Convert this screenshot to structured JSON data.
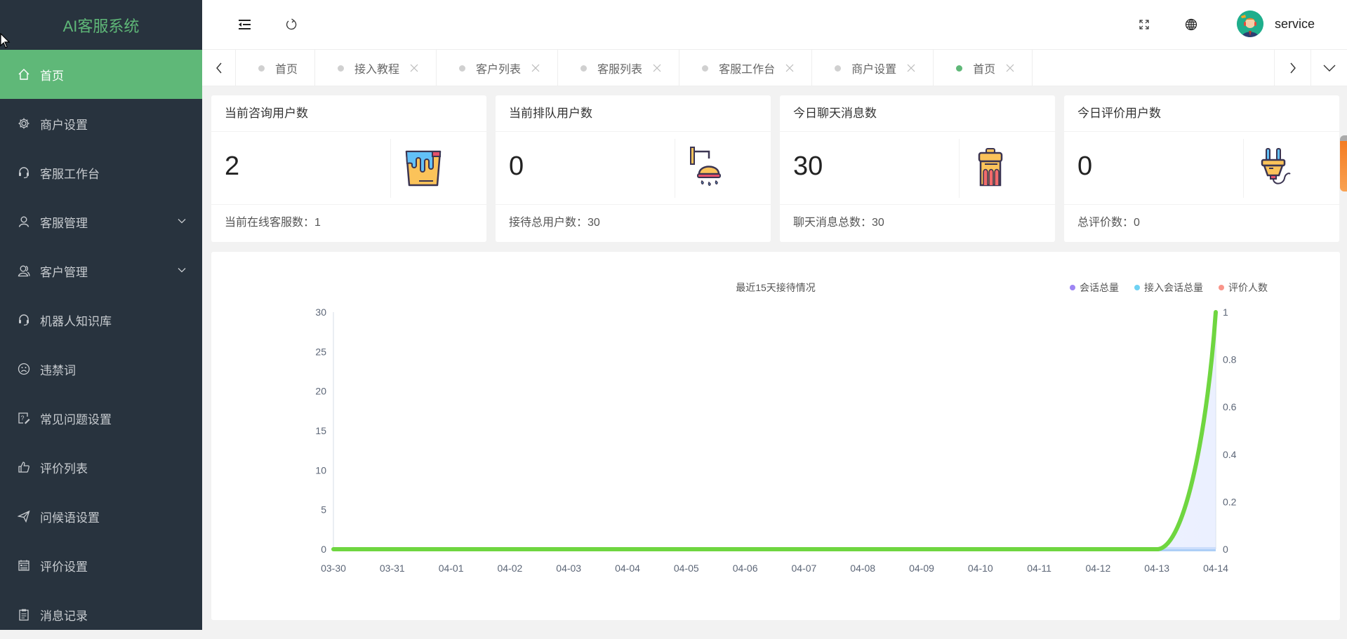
{
  "app": {
    "title": "AI客服系统"
  },
  "sidebar": {
    "items": [
      {
        "label": "首页",
        "icon": "home-icon",
        "active": true,
        "expandable": false
      },
      {
        "label": "商户设置",
        "icon": "gear-icon",
        "active": false,
        "expandable": false
      },
      {
        "label": "客服工作台",
        "icon": "headset-icon",
        "active": false,
        "expandable": false
      },
      {
        "label": "客服管理",
        "icon": "user-icon",
        "active": false,
        "expandable": true
      },
      {
        "label": "客户管理",
        "icon": "users-icon",
        "active": false,
        "expandable": true
      },
      {
        "label": "机器人知识库",
        "icon": "headset-icon",
        "active": false,
        "expandable": false
      },
      {
        "label": "违禁词",
        "icon": "sad-face-icon",
        "active": false,
        "expandable": false
      },
      {
        "label": "常见问题设置",
        "icon": "question-edit-icon",
        "active": false,
        "expandable": false
      },
      {
        "label": "评价列表",
        "icon": "thumbs-up-icon",
        "active": false,
        "expandable": false
      },
      {
        "label": "问候语设置",
        "icon": "paper-plane-icon",
        "active": false,
        "expandable": false
      },
      {
        "label": "评价设置",
        "icon": "calendar-list-icon",
        "active": false,
        "expandable": false
      },
      {
        "label": "消息记录",
        "icon": "clipboard-icon",
        "active": false,
        "expandable": false
      }
    ]
  },
  "header": {
    "collapse_icon": "menu-fold-icon",
    "refresh_icon": "refresh-icon",
    "fullscreen_icon": "fullscreen-icon",
    "language_icon": "globe-icon",
    "username": "service"
  },
  "tabs": [
    {
      "label": "首页",
      "closable": false,
      "active": false
    },
    {
      "label": "接入教程",
      "closable": true,
      "active": false
    },
    {
      "label": "客户列表",
      "closable": true,
      "active": false
    },
    {
      "label": "客服列表",
      "closable": true,
      "active": false
    },
    {
      "label": "客服工作台",
      "closable": true,
      "active": false
    },
    {
      "label": "商户设置",
      "closable": true,
      "active": false
    },
    {
      "label": "首页",
      "closable": true,
      "active": true
    }
  ],
  "cards": [
    {
      "title": "当前咨询用户数",
      "value": "2",
      "footer": "当前在线客服数：1",
      "icon": "paint-bucket-icon"
    },
    {
      "title": "当前排队用户数",
      "value": "0",
      "footer": "接待总用户数：30",
      "icon": "shower-icon"
    },
    {
      "title": "今日聊天消息数",
      "value": "30",
      "footer": "聊天消息总数：30",
      "icon": "trash-can-icon"
    },
    {
      "title": "今日评价用户数",
      "value": "0",
      "footer": "总评价数：0",
      "icon": "plug-icon"
    }
  ],
  "colors": {
    "brand": "#5fb878",
    "sidebar_bg": "#28333e"
  },
  "chart_data": {
    "type": "line",
    "title": "最近15天接待情况",
    "legend_position": "top-right",
    "categories": [
      "03-30",
      "03-31",
      "04-01",
      "04-02",
      "04-03",
      "04-04",
      "04-05",
      "04-06",
      "04-07",
      "04-08",
      "04-09",
      "04-10",
      "04-11",
      "04-12",
      "04-13",
      "04-14"
    ],
    "y_left": {
      "min": 0,
      "max": 30,
      "ticks": [
        0,
        5,
        10,
        15,
        20,
        25,
        30
      ]
    },
    "y_right": {
      "min": 0,
      "max": 1,
      "ticks": [
        "0",
        "0.2",
        "0.4",
        "0.6",
        "0.8",
        "1"
      ]
    },
    "grid": false,
    "series": [
      {
        "name": "会话总量",
        "color": "#9d85f3",
        "axis": "left",
        "values": [
          0,
          0,
          0,
          0,
          0,
          0,
          0,
          0,
          0,
          0,
          0,
          0,
          0,
          0,
          0,
          0
        ]
      },
      {
        "name": "接入会话总量",
        "color": "#6fd2f3",
        "axis": "left",
        "values": [
          0,
          0,
          0,
          0,
          0,
          0,
          0,
          0,
          0,
          0,
          0,
          0,
          0,
          0,
          0,
          0
        ]
      },
      {
        "name": "评价人数",
        "color": "#f9958a",
        "axis": "right",
        "values": [
          0,
          0,
          0,
          0,
          0,
          0,
          0,
          0,
          0,
          0,
          0,
          0,
          0,
          0,
          0,
          0
        ]
      },
      {
        "name": "",
        "color": "#6fd640",
        "axis": "right",
        "values": [
          0,
          0,
          0,
          0,
          0,
          0,
          0,
          0,
          0,
          0,
          0,
          0,
          0,
          0,
          0,
          1
        ]
      }
    ]
  }
}
